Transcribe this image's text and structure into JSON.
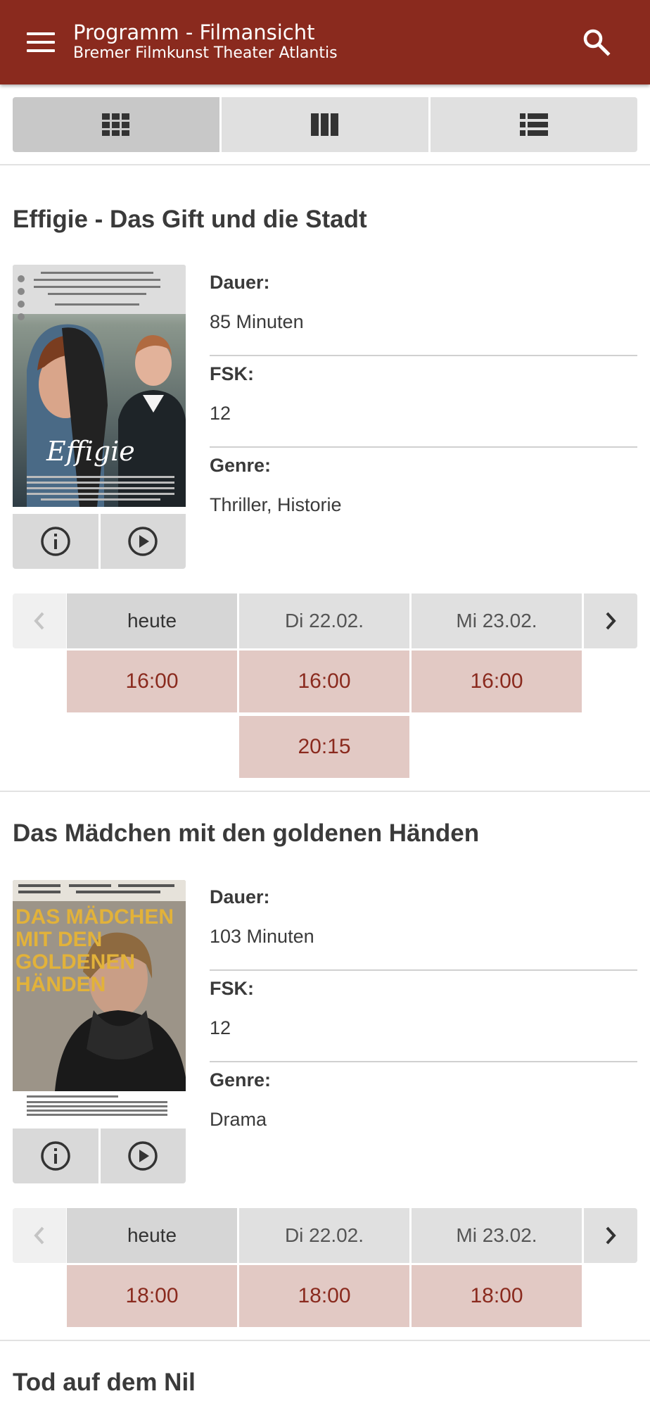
{
  "header": {
    "title": "Programm - Filmansicht",
    "subtitle": "Bremer Filmkunst Theater Atlantis",
    "menu_icon": "menu-icon",
    "search_icon": "search-icon",
    "color": "#8a2a1e"
  },
  "view_tabs": [
    {
      "icon": "grid-view-icon",
      "selected": true
    },
    {
      "icon": "column-view-icon",
      "selected": false
    },
    {
      "icon": "list-view-icon",
      "selected": false
    }
  ],
  "labels": {
    "duration": "Dauer:",
    "fsk": "FSK:",
    "genre": "Genre:"
  },
  "films": [
    {
      "title": "Effigie - Das Gift und die Stadt",
      "poster_text": "Effigie",
      "duration": "85 Minuten",
      "fsk": "12",
      "genre": "Thriller, Historie",
      "days": [
        "heute",
        "Di 22.02.",
        "Mi 23.02."
      ],
      "times": [
        [
          "16:00"
        ],
        [
          "16:00",
          "20:15"
        ],
        [
          "16:00"
        ]
      ]
    },
    {
      "title": "Das Mädchen mit den goldenen Händen",
      "poster_text": "DAS MÄDCHEN MIT DEN GOLDENEN HÄNDEN",
      "duration": "103 Minuten",
      "fsk": "12",
      "genre": "Drama",
      "days": [
        "heute",
        "Di 22.02.",
        "Mi 23.02."
      ],
      "times": [
        [
          "18:00"
        ],
        [
          "18:00"
        ],
        [
          "18:00"
        ]
      ]
    },
    {
      "title": "Tod auf dem Nil"
    }
  ]
}
